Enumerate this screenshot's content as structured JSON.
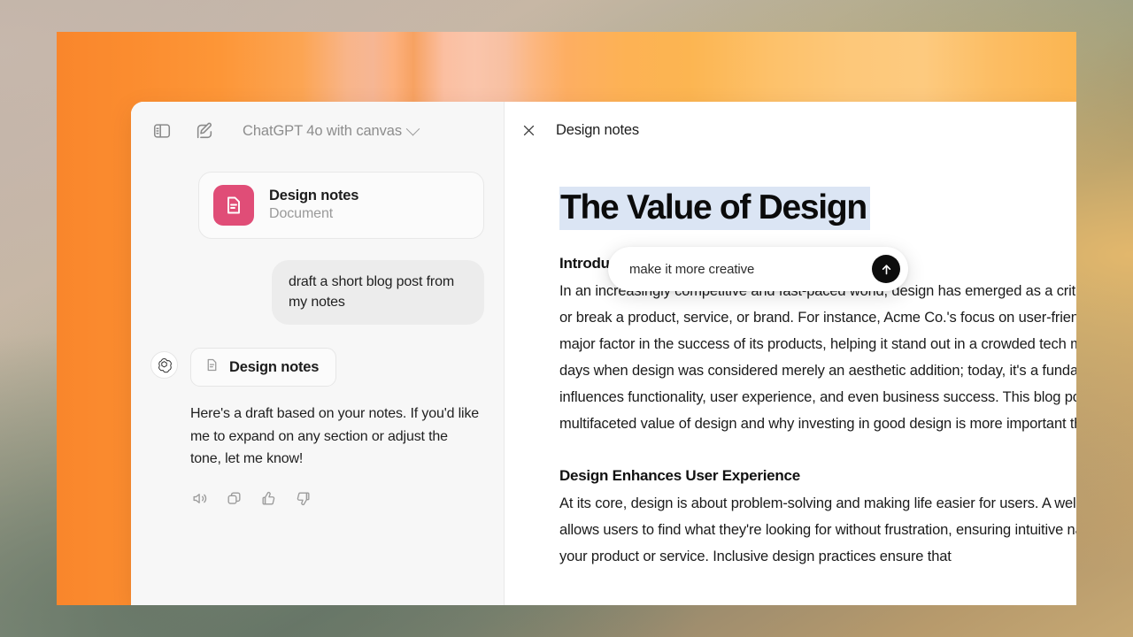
{
  "chat": {
    "topbar": {
      "sidebar_toggle_icon": "sidebar-panel-icon",
      "new_chat_icon": "compose-pencil-icon",
      "model_label": "ChatGPT 4o with canvas",
      "chevron_icon": "chevron-down-icon"
    },
    "attachment": {
      "icon": "document-file-icon",
      "title": "Design notes",
      "subtitle": "Document",
      "accent_color": "#e04d77"
    },
    "user_message": "draft a short blog post from my notes",
    "assistant": {
      "avatar_icon": "openai-logo-icon",
      "canvas_pill_icon": "document-file-icon",
      "canvas_pill_label": "Design notes",
      "text": "Here's a draft based on your notes. If you'd like me to expand on any section or adjust the tone, let me know!",
      "actions": [
        {
          "name": "read-aloud-icon",
          "label": "Read aloud"
        },
        {
          "name": "copy-icon",
          "label": "Copy"
        },
        {
          "name": "thumbs-up-icon",
          "label": "Good response"
        },
        {
          "name": "thumbs-down-icon",
          "label": "Bad response"
        }
      ]
    }
  },
  "canvas": {
    "close_icon": "close-x-icon",
    "title": "Design notes",
    "document": {
      "heading": "The Value of Design",
      "heading_highlight_color": "#dbe5f4",
      "sections": [
        {
          "heading": "Introduction",
          "body": "In an increasingly competitive and fast-paced world, design has emerged as a critical factor that can make or break a product, service, or brand. For instance, Acme Co.'s focus on user-friendly design has been a major factor in the success of its products, helping it stand out in a crowded tech market. Gone are the days when design was considered merely an aesthetic addition; today, it's a fundamental component that influences functionality, user experience, and even business success. This blog post delves into the multifaceted value of design and why investing in good design is more important than ever."
        },
        {
          "heading": "Design Enhances User Experience",
          "body": "At its core, design is about problem-solving and making life easier for users. A well-designed interface allows users to find what they're looking for without frustration, ensuring intuitive navigation throughout your product or service. Inclusive design practices ensure that"
        }
      ]
    },
    "prompt_pill": {
      "value": "make it more creative",
      "placeholder": "make it more creative",
      "send_icon": "arrow-up-icon"
    }
  }
}
